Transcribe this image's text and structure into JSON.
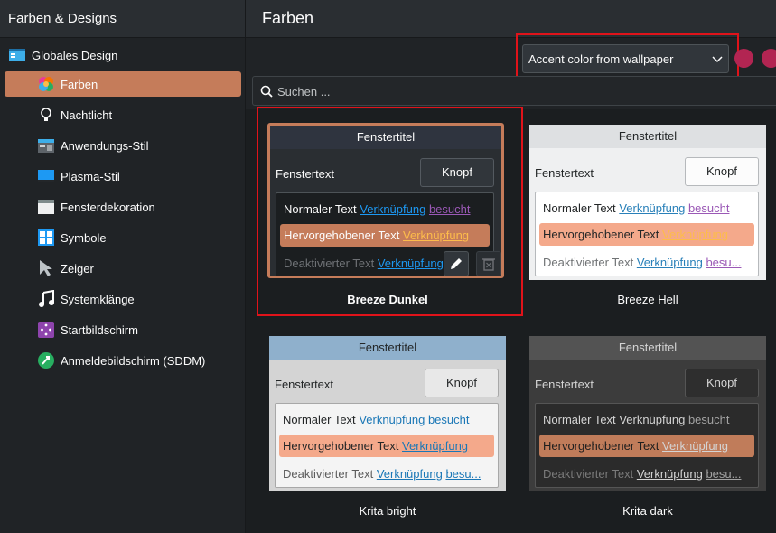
{
  "sidebar_header": "Farben & Designs",
  "page_title": "Farben",
  "sidebar": {
    "top_item": {
      "label": "Globales Design",
      "icon": "global-theme-icon"
    },
    "items": [
      {
        "label": "Farben",
        "icon": "colors-icon",
        "active": true
      },
      {
        "label": "Nachtlicht",
        "icon": "night-light-icon"
      },
      {
        "label": "Anwendungs-Stil",
        "icon": "application-style-icon"
      },
      {
        "label": "Plasma-Stil",
        "icon": "plasma-style-icon"
      },
      {
        "label": "Fensterdekoration",
        "icon": "window-decoration-icon"
      },
      {
        "label": "Symbole",
        "icon": "icons-icon"
      },
      {
        "label": "Zeiger",
        "icon": "cursor-icon"
      },
      {
        "label": "Systemklänge",
        "icon": "system-sounds-icon"
      },
      {
        "label": "Startbildschirm",
        "icon": "splash-screen-icon"
      },
      {
        "label": "Anmeldebildschirm (SDDM)",
        "icon": "login-screen-icon"
      }
    ]
  },
  "toolbar": {
    "accent_option": "Accent color from wallpaper",
    "accent_swatch_colors": [
      "#b22552",
      "#b22552"
    ]
  },
  "search": {
    "placeholder": "Suchen ..."
  },
  "schemes": [
    {
      "name": "Breeze Dunkel",
      "selected": true,
      "titlebar": "Fenstertitel",
      "window_text": "Fenstertext",
      "button": "Knopf",
      "normal_text": "Normaler Text",
      "link": "Verknüpfung",
      "visited": "besucht",
      "highlighted_text": "Hervorgehobener Text",
      "disabled_text": "Deaktivierter Text",
      "colors": {
        "titlebar_bg": "#2f343f",
        "titlebar_fg": "#fcfcfc",
        "window_bg": "#2a2e32",
        "window_fg": "#fcfcfc",
        "button_bg": "#31363b",
        "view_bg": "#1b1e20",
        "view_fg": "#fcfcfc",
        "highlight": "#c57c5a",
        "highlight_fg": "#fcfcfc",
        "link": "#1d99f3",
        "visited": "#9b59b6",
        "disabled": "#6e7175",
        "highlight_link": "#fdbc4b"
      }
    },
    {
      "name": "Breeze Hell",
      "titlebar": "Fenstertitel",
      "window_text": "Fenstertext",
      "button": "Knopf",
      "normal_text": "Normaler Text",
      "link": "Verknüpfung",
      "visited": "besucht",
      "highlighted_text": "Hervorgehobener Text",
      "disabled_text": "Deaktivierter Text",
      "visited_short": "besu...",
      "colors": {
        "titlebar_bg": "#dee0e2",
        "titlebar_fg": "#232627",
        "window_bg": "#eff0f1",
        "window_fg": "#232627",
        "button_bg": "#fcfcfc",
        "view_bg": "#ffffff",
        "view_fg": "#232627",
        "highlight": "#f4a98b",
        "highlight_fg": "#232627",
        "link": "#2980b9",
        "visited": "#9b59b6",
        "disabled": "#707375",
        "highlight_link": "#fdbc4b"
      }
    },
    {
      "name": "Krita bright",
      "titlebar": "Fenstertitel",
      "window_text": "Fenstertext",
      "button": "Knopf",
      "normal_text": "Normaler Text",
      "link": "Verknüpfung",
      "visited": "besucht",
      "highlighted_text": "Hervorgehobener Text",
      "disabled_text": "Deaktivierter Text",
      "visited_short": "besu...",
      "colors": {
        "titlebar_bg": "#8fb0cc",
        "titlebar_fg": "#232627",
        "window_bg": "#d4d4d4",
        "window_fg": "#232627",
        "button_bg": "#e8e8e8",
        "view_bg": "#f4f4f4",
        "view_fg": "#232627",
        "highlight": "#f4a98b",
        "highlight_fg": "#232627",
        "link": "#1a77b6",
        "visited": "#1a77b6",
        "disabled": "#5c5c5c",
        "highlight_link": "#1a77b6"
      }
    },
    {
      "name": "Krita dark",
      "titlebar": "Fenstertitel",
      "window_text": "Fenstertext",
      "button": "Knopf",
      "normal_text": "Normaler Text",
      "link": "Verknüpfung",
      "visited": "besucht",
      "highlighted_text": "Hervorgehobener Text",
      "disabled_text": "Deaktivierter Text",
      "visited_short": "besu...",
      "colors": {
        "titlebar_bg": "#535353",
        "titlebar_fg": "#d4d4d4",
        "window_bg": "#3c3c3c",
        "window_fg": "#d4d4d4",
        "button_bg": "#2e2e2e",
        "view_bg": "#2b2b2b",
        "view_fg": "#d4d4d4",
        "highlight": "#c07c5a",
        "highlight_fg": "#1e1e1e",
        "link": "#d4d4d4",
        "visited": "#a3a3a3",
        "disabled": "#7a7a7a",
        "highlight_link": "#d4d4d4"
      }
    }
  ]
}
